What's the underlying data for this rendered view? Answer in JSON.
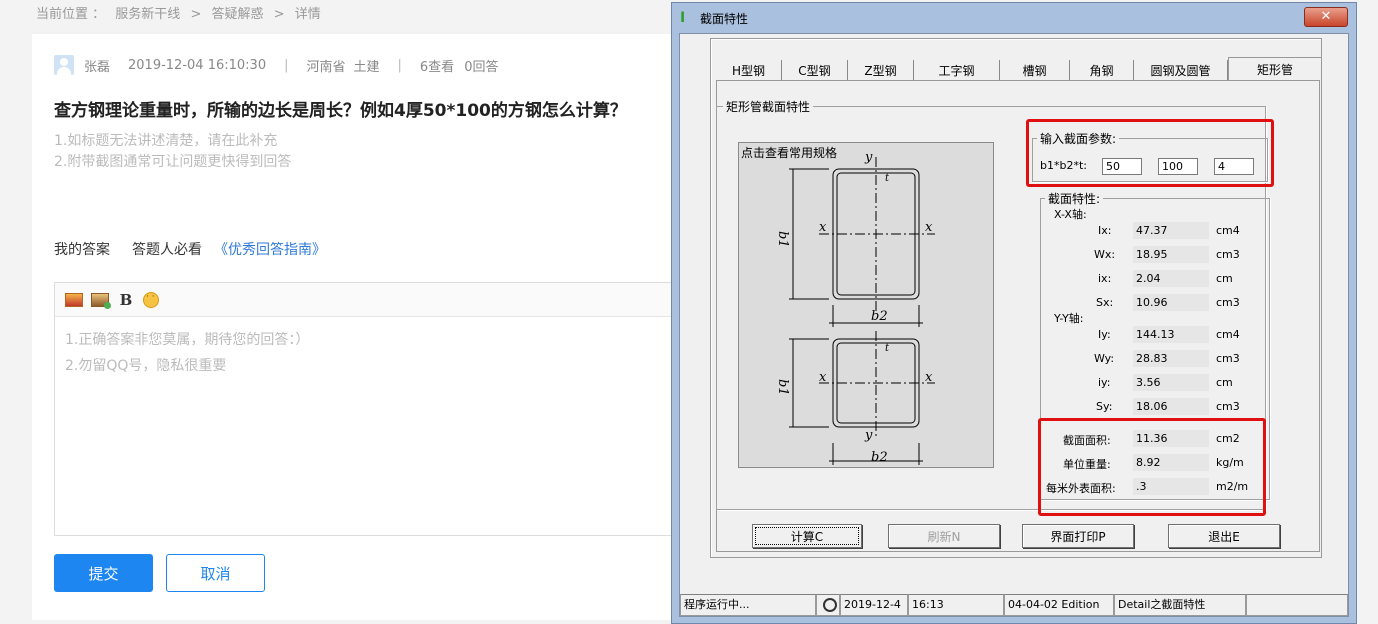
{
  "breadcrumb": {
    "prefix": "当前位置 ：",
    "items": [
      "服务新干线",
      ">",
      "答疑解惑",
      ">",
      "详情"
    ]
  },
  "question": {
    "user": "张磊",
    "datetime": "2019-12-04 16:10:30",
    "sep": "|",
    "region": "河南省",
    "category": "土建",
    "views": "6查看",
    "answers": "0回答",
    "title": "查方钢理论重量时，所输的边长是周长？例如4厚50*100的方钢怎么计算？",
    "hint1": "1.如标题无法讲述清楚，请在此补充",
    "hint2": "2.附带截图通常可让问题更快得到回答"
  },
  "answer": {
    "my_answer": "我的答案",
    "must_read": "答题人必看",
    "guide_link": "《优秀回答指南》",
    "placeholder1": "1.正确答案非您莫属，期待您的回答：）",
    "placeholder2": "2.勿留QQ号，隐私很重要",
    "bold_label": "B",
    "submit": "提交",
    "cancel": "取消"
  },
  "dialog": {
    "title": "截面特性",
    "close": "✕",
    "tabs": [
      "H型钢",
      "C型钢",
      "Z型钢",
      "工字钢",
      "槽钢",
      "角钢",
      "圆钢及圆管",
      "矩形管"
    ],
    "active_tab": 7,
    "group_title": "矩形管截面特性",
    "drawing_label": "点击查看常用规格",
    "input_group": "输入截面参数:",
    "input_label": "b1*b2*t:",
    "b1": "50",
    "b2": "100",
    "t": "4",
    "props_group": "截面特性:",
    "xx_axis": "X-X轴:",
    "yy_axis": "Y-Y轴:",
    "xx": [
      {
        "label": "Ix:",
        "value": "47.37",
        "unit": "cm4"
      },
      {
        "label": "Wx:",
        "value": "18.95",
        "unit": "cm3"
      },
      {
        "label": "ix:",
        "value": "2.04",
        "unit": "cm"
      },
      {
        "label": "Sx:",
        "value": "10.96",
        "unit": "cm3"
      }
    ],
    "yy": [
      {
        "label": "Iy:",
        "value": "144.13",
        "unit": "cm4"
      },
      {
        "label": "Wy:",
        "value": "28.83",
        "unit": "cm3"
      },
      {
        "label": "iy:",
        "value": "3.56",
        "unit": "cm"
      },
      {
        "label": "Sy:",
        "value": "18.06",
        "unit": "cm3"
      }
    ],
    "area_label": "截面面积:",
    "area_value": "11.36",
    "area_unit": "cm2",
    "weight_label": "单位重量:",
    "weight_value": "8.92",
    "weight_unit": "kg/m",
    "surface_label": "每米外表面积:",
    "surface_value": ".3",
    "surface_unit": "m2/m",
    "buttons": {
      "calc": "计算C",
      "refresh": "刷新N",
      "print": "界面打印P",
      "exit": "退出E"
    },
    "status": {
      "running": "程序运行中...",
      "date": "2019-12-4",
      "time": "16:13",
      "edition": "04-04-02 Edition",
      "detail": "Detail之截面特性"
    }
  },
  "colors": {
    "accent": "#1e86f0",
    "highlight_box": "#e01010",
    "dialog_frame": "#a9c1de"
  }
}
